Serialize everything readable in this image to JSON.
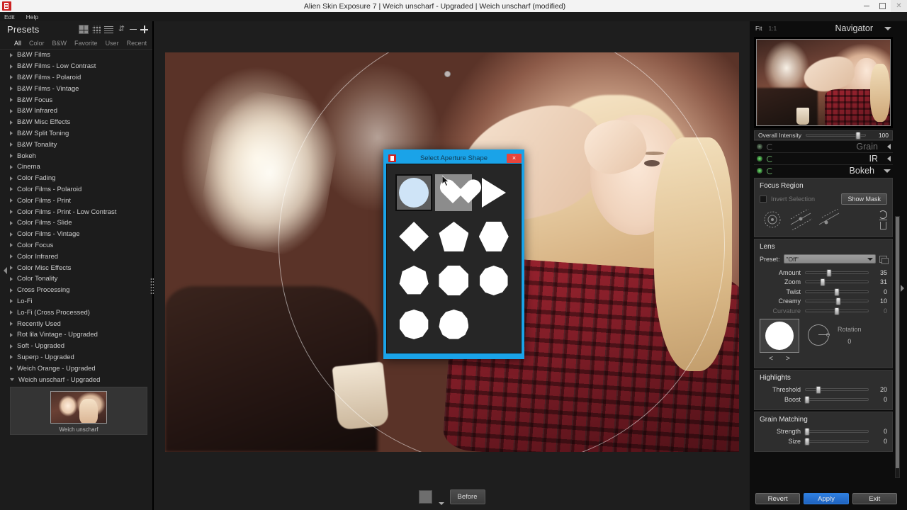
{
  "window": {
    "title": "Alien Skin Exposure 7 | Weich unscharf - Upgraded | Weich unscharf (modified)",
    "app_icon": "app-icon",
    "minimize": "minimize-icon",
    "maximize": "restore-icon",
    "close": "close-icon"
  },
  "menubar": {
    "items": [
      "Edit",
      "Help"
    ]
  },
  "presets": {
    "title": "Presets",
    "tools": [
      "grid-large-icon",
      "grid-small-icon",
      "list-icon",
      "collapse-all-icon",
      "minus-icon",
      "plus-icon"
    ],
    "filters": [
      "All",
      "Color",
      "B&W",
      "Favorite",
      "User",
      "Recent"
    ],
    "active_filter": "All",
    "search_icon": "search-icon",
    "items": [
      "B&W Films",
      "B&W Films - Low Contrast",
      "B&W Films - Polaroid",
      "B&W Films - Vintage",
      "B&W Focus",
      "B&W Infrared",
      "B&W Misc Effects",
      "B&W Split Toning",
      "B&W Tonality",
      "Bokeh",
      "Cinema",
      "Color Fading",
      "Color Films - Polaroid",
      "Color Films - Print",
      "Color Films - Print - Low Contrast",
      "Color Films - Slide",
      "Color Films - Vintage",
      "Color Focus",
      "Color Infrared",
      "Color Misc Effects",
      "Color Tonality",
      "Cross Processing",
      "Lo-Fi",
      "Lo-Fi (Cross Processed)",
      "Recently Used",
      "Rot lila Vintage - Upgraded",
      "Soft - Upgraded",
      "Superp - Upgraded",
      "Weich Orange - Upgraded"
    ],
    "expanded_item": "Weich unscharf - Upgraded",
    "expanded_thumb_label": "Weich unscharf"
  },
  "bottombar": {
    "swatch": "color-swatch",
    "before_label": "Before"
  },
  "navigator": {
    "fit_label": "Fit",
    "one_to_one_label": "1:1",
    "title": "Navigator",
    "caret": "chevron-down-icon"
  },
  "overall_intensity": {
    "label": "Overall Intensity",
    "value": "100"
  },
  "sections": [
    {
      "name": "Grain",
      "enabled": false,
      "caret": "chevron-left-icon"
    },
    {
      "name": "IR",
      "enabled": true,
      "caret": "chevron-left-icon"
    },
    {
      "name": "Bokeh",
      "enabled": true,
      "caret": "chevron-down-icon"
    }
  ],
  "focus_region": {
    "title": "Focus Region",
    "invert_label": "Invert Selection",
    "invert_checked": false,
    "show_mask_label": "Show Mask",
    "tools": [
      "radial-focus-icon",
      "planar-focus-icon",
      "gradient-focus-icon"
    ],
    "reset_icon": "reset-icon",
    "delete_icon": "trash-icon"
  },
  "lens": {
    "title": "Lens",
    "preset_label": "Preset:",
    "preset_value": "\"Off\"",
    "copy_icon": "copy-settings-icon",
    "sliders": [
      {
        "label": "Amount",
        "value": "35",
        "pct": 38,
        "disabled": false
      },
      {
        "label": "Zoom",
        "value": "31",
        "pct": 27,
        "disabled": false
      },
      {
        "label": "Twist",
        "value": "0",
        "pct": 50,
        "disabled": false
      },
      {
        "label": "Creamy",
        "value": "10",
        "pct": 52,
        "disabled": false
      },
      {
        "label": "Curvature",
        "value": "0",
        "pct": 50,
        "disabled": true
      }
    ],
    "aperture": {
      "shape": "circle",
      "prev_label": "<",
      "next_label": ">",
      "rotation_label": "Rotation",
      "rotation_value": "0"
    }
  },
  "highlights": {
    "title": "Highlights",
    "sliders": [
      {
        "label": "Threshold",
        "value": "20",
        "pct": 20,
        "disabled": false
      },
      {
        "label": "Boost",
        "value": "0",
        "pct": 2,
        "disabled": false
      }
    ]
  },
  "grain_matching": {
    "title": "Grain Matching",
    "sliders": [
      {
        "label": "Strength",
        "value": "0",
        "pct": 2,
        "disabled": false
      },
      {
        "label": "Size",
        "value": "0",
        "pct": 2,
        "disabled": false
      }
    ]
  },
  "actions": {
    "revert": "Revert",
    "apply": "Apply",
    "exit": "Exit"
  },
  "dialog": {
    "title": "Select Aperture Shape",
    "app_icon": "app-icon",
    "close_label": "×",
    "shapes": [
      {
        "name": "circle",
        "state": "selected"
      },
      {
        "name": "heart",
        "state": "hover"
      },
      {
        "name": "triangle",
        "state": "normal"
      },
      {
        "name": "diamond",
        "state": "normal"
      },
      {
        "name": "pentagon",
        "state": "normal"
      },
      {
        "name": "hexagon",
        "state": "normal"
      },
      {
        "name": "heptagon",
        "state": "normal"
      },
      {
        "name": "octagon",
        "state": "normal"
      },
      {
        "name": "nonagon",
        "state": "normal"
      },
      {
        "name": "decagon",
        "state": "normal"
      },
      {
        "name": "hendecagon",
        "state": "normal"
      }
    ]
  }
}
